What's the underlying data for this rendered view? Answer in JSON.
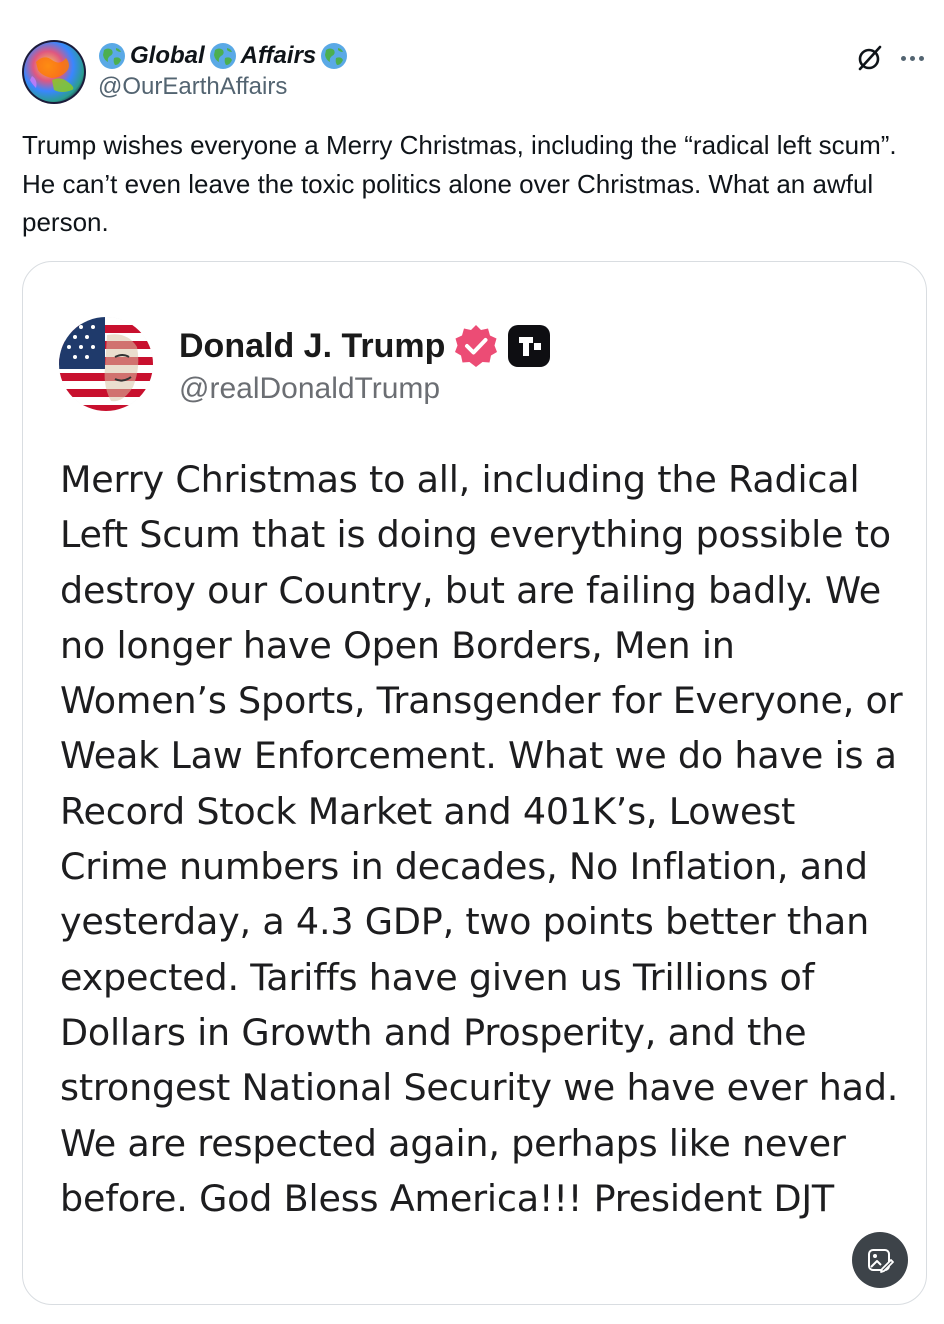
{
  "post": {
    "author": {
      "name_part1": "Global",
      "name_part2": "Affairs",
      "handle": "@OurEarthAffairs",
      "name_icon": "globe-emoji-icon"
    },
    "text": "Trump wishes everyone a Merry Christmas, including the “radical left scum”. He can’t even leave the toxic politics alone over Christmas. What an awful person.",
    "actions": {
      "grok_icon": "grok-icon",
      "more_icon": "more-options-icon"
    }
  },
  "embedded_post": {
    "author_name": "Donald J. Trump",
    "author_handle": "@realDonaldTrump",
    "verified_icon": "verified-badge-icon",
    "platform_icon": "truth-social-icon",
    "text": "Merry Christmas to all, including the Radical Left Scum that is doing everything possible to destroy our Country, but are failing badly. We no longer have Open Borders, Men in Women’s Sports, Transgender for Everyone, or Weak Law Enforcement. What we do have is a Record Stock Market and 401K’s, Lowest Crime numbers in decades, No Inflation, and yesterday, a 4.3 GDP, two points better than expected. Tariffs have given us Trillions of Dollars in Growth and Prosperity, and the strongest National Security we have ever had. We are respected again, perhaps like never before. God Bless America!!! President DJT",
    "image_action_icon": "edit-image-icon"
  },
  "colors": {
    "text_primary": "#0f1419",
    "text_secondary": "#536471",
    "card_border": "#d9dde1",
    "verified_pink": "#ec4c75"
  }
}
